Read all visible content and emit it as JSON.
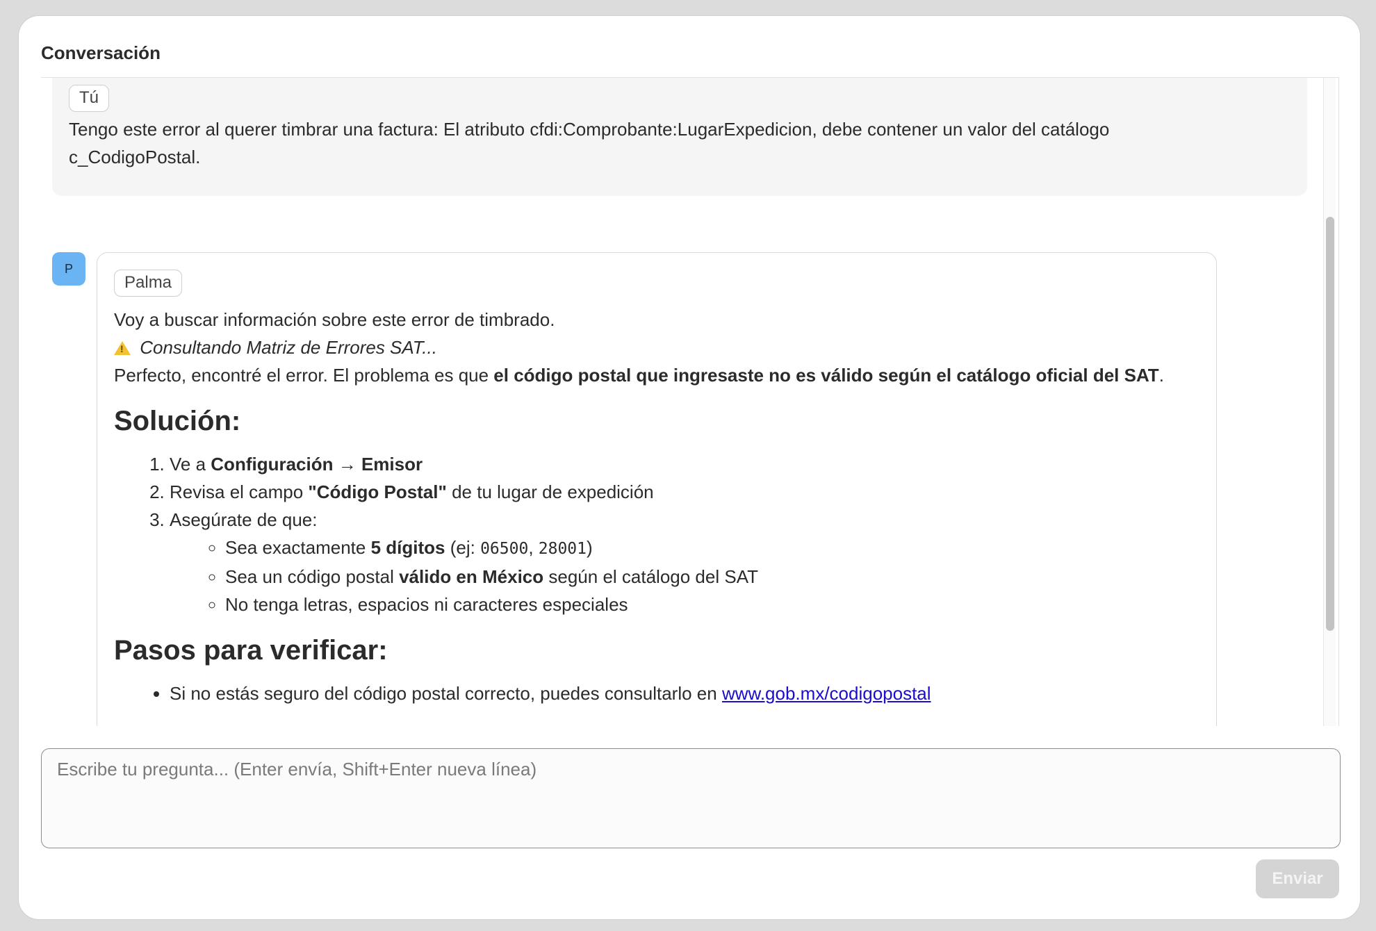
{
  "header": {
    "title": "Conversación"
  },
  "user_message": {
    "sender": "Tú",
    "text": "Tengo este error al querer timbrar una factura: El atributo cfdi:Comprobante:LugarExpedicion, debe contener un valor del catálogo c_CodigoPostal."
  },
  "assistant_message": {
    "avatar_letter": "P",
    "sender": "Palma",
    "intro": "Voy a buscar información sobre este error de timbrado.",
    "status": {
      "icon": "warning-icon",
      "text": "Consultando Matriz de Errores SAT..."
    },
    "found_prefix": "Perfecto, encontré el error. El problema es que ",
    "found_bold": "el código postal que ingresaste no es válido según el catálogo oficial del SAT",
    "found_suffix": ".",
    "solution_heading": "Solución:",
    "steps": [
      {
        "prefix": "Ve a ",
        "bold": "Configuración → Emisor",
        "suffix": ""
      },
      {
        "prefix": "Revisa el campo ",
        "bold": "\"Código Postal\"",
        "suffix": " de tu lugar de expedición"
      },
      {
        "prefix": "Asegúrate de que:",
        "bold": "",
        "suffix": ""
      }
    ],
    "substeps": [
      {
        "prefix": "Sea exactamente ",
        "bold": "5 dígitos",
        "mid": " (ej: ",
        "code1": "06500",
        "sep": ", ",
        "code2": "28001",
        "suffix": ")"
      },
      {
        "prefix": "Sea un código postal ",
        "bold": "válido en México",
        "suffix": " según el catálogo del SAT"
      },
      {
        "prefix": "No tenga letras, espacios ni caracteres especiales"
      }
    ],
    "verify_heading": "Pasos para verificar:",
    "verify_items": [
      {
        "prefix": "Si no estás seguro del código postal correcto, puedes consultarlo en ",
        "link": "www.gob.mx/codigopostal"
      }
    ]
  },
  "composer": {
    "placeholder": "Escribe tu pregunta... (Enter envía, Shift+Enter nueva línea)",
    "value": "",
    "send_label": "Enviar"
  },
  "colors": {
    "avatar": "#6ab4f4",
    "link": "#1a0dcc",
    "send_disabled": "#d4d4d4",
    "user_bubble": "#f5f5f5"
  }
}
